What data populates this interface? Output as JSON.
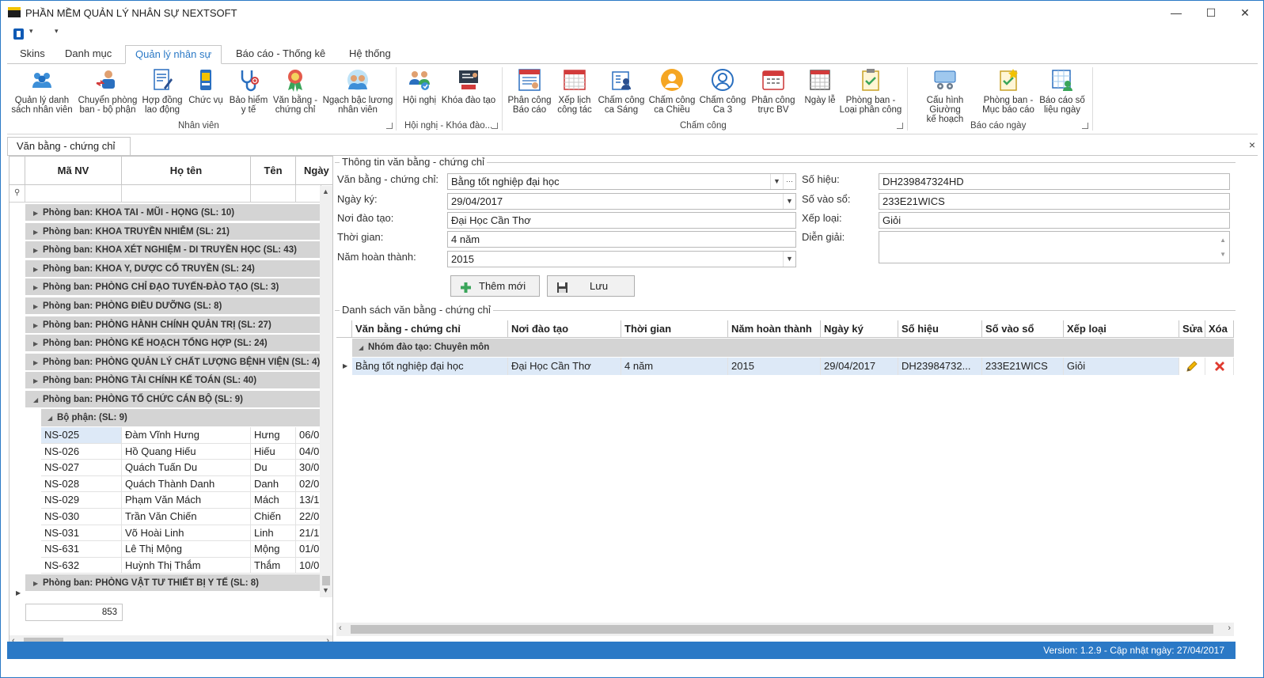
{
  "window": {
    "title": "PHẦN MỀM QUẢN LÝ NHÂN SỰ NEXTSOFT",
    "minimize": "—",
    "maximize": "☐",
    "close": "✕"
  },
  "ribbon_tabs": [
    "Skins",
    "Danh mục",
    "Quản lý nhân sự",
    "Báo cáo - Thống kê",
    "Hệ thống"
  ],
  "ribbon_groups": [
    {
      "label": "Nhân viên",
      "buttons": [
        {
          "l1": "Quản lý danh",
          "l2": "sách nhân viên",
          "icon": "people-icon"
        },
        {
          "l1": "Chuyển phòng",
          "l2": "ban - bộ phận",
          "icon": "transfer-icon"
        },
        {
          "l1": "Hợp đồng",
          "l2": "lao động",
          "icon": "contract-icon"
        },
        {
          "l1": "Chức vụ",
          "l2": "",
          "icon": "id-card-icon"
        },
        {
          "l1": "Bảo hiểm",
          "l2": "y tế",
          "icon": "stethoscope-icon"
        },
        {
          "l1": "Văn bằng -",
          "l2": "chứng chỉ",
          "icon": "medal-icon"
        },
        {
          "l1": "Ngạch bậc lương",
          "l2": "nhân viên",
          "icon": "salary-icon"
        }
      ]
    },
    {
      "label": "Hội nghị - Khóa đào...",
      "buttons": [
        {
          "l1": "Hội nghị",
          "l2": "",
          "icon": "meeting-icon"
        },
        {
          "l1": "Khóa đào tạo",
          "l2": "",
          "icon": "training-icon"
        }
      ]
    },
    {
      "label": "Chấm công",
      "buttons": [
        {
          "l1": "Phân công",
          "l2": "Báo cáo",
          "icon": "report-assign-icon"
        },
        {
          "l1": "Xếp lịch",
          "l2": "công tác",
          "icon": "calendar-grid-icon"
        },
        {
          "l1": "Chấm công",
          "l2": "ca Sáng",
          "icon": "morning-shift-icon"
        },
        {
          "l1": "Chấm công",
          "l2": "ca Chiều",
          "icon": "afternoon-shift-icon"
        },
        {
          "l1": "Chấm công",
          "l2": "Ca 3",
          "icon": "night-shift-icon"
        },
        {
          "l1": "Phân công",
          "l2": "trực BV",
          "icon": "duty-calendar-icon"
        },
        {
          "l1": "Ngày lễ",
          "l2": "",
          "icon": "holiday-calendar-icon"
        },
        {
          "l1": "Phòng ban -",
          "l2": "Loại phân công",
          "icon": "clipboard-check-icon"
        }
      ]
    },
    {
      "label": "Báo cáo ngày",
      "buttons": [
        {
          "l1": "Cấu hình Giường",
          "l2": "kế hoạch",
          "icon": "bed-config-icon"
        },
        {
          "l1": "Phòng ban -",
          "l2": "Mục báo cáo",
          "icon": "report-item-icon"
        },
        {
          "l1": "Báo cáo số",
          "l2": "liệu ngày",
          "icon": "daily-report-icon"
        }
      ]
    }
  ],
  "doc_tab": {
    "label": "Văn bằng - chứng chỉ",
    "close": "×"
  },
  "left_grid": {
    "columns": [
      "Mã NV",
      "Họ tên",
      "Tên",
      "Ngày"
    ],
    "groups_before": [
      "Phòng ban: KHOA TAI - MŨI - HỌNG (SL: 10)",
      "Phòng ban: KHOA TRUYỀN NHIỄM (SL: 21)",
      "Phòng ban: KHOA XÉT NGHIỆM - DI TRUYỀN HỌC (SL: 43)",
      "Phòng ban: KHOA Y, DƯỢC CỔ TRUYỀN (SL: 24)",
      "Phòng ban: PHÒNG CHỈ ĐẠO TUYẾN-ĐÀO TẠO (SL: 3)",
      "Phòng ban: PHÒNG ĐIỀU DƯỠNG (SL: 8)",
      "Phòng ban: PHÒNG HÀNH CHÍNH QUẢN TRỊ (SL: 27)",
      "Phòng ban: PHÒNG KẾ HOẠCH TỔNG HỢP (SL: 24)",
      "Phòng ban: PHÒNG QUẢN LÝ CHẤT LƯỢNG BỆNH VIỆN (SL: 4)",
      "Phòng ban: PHÒNG TÀI CHÍNH KẾ TOÁN (SL: 40)",
      "Phòng ban: PHÒNG TỔ CHỨC CÁN BỘ (SL: 9)"
    ],
    "subgroup": "Bộ phận:  (SL: 9)",
    "rows": [
      {
        "ma": "NS-025",
        "hoten": "Đàm Vĩnh Hưng",
        "ten": "Hưng",
        "ngay": "06/0"
      },
      {
        "ma": "NS-026",
        "hoten": "Hồ Quang Hiếu",
        "ten": "Hiếu",
        "ngay": "04/0"
      },
      {
        "ma": "NS-027",
        "hoten": "Quách Tuấn Du",
        "ten": "Du",
        "ngay": "30/0"
      },
      {
        "ma": "NS-028",
        "hoten": "Quách Thành Danh",
        "ten": "Danh",
        "ngay": "02/0"
      },
      {
        "ma": "NS-029",
        "hoten": "Phạm Văn Mách",
        "ten": "Mách",
        "ngay": "13/1"
      },
      {
        "ma": "NS-030",
        "hoten": "Trần Văn Chiến",
        "ten": "Chiến",
        "ngay": "22/0"
      },
      {
        "ma": "NS-031",
        "hoten": "Võ Hoài Linh",
        "ten": "Linh",
        "ngay": "21/1"
      },
      {
        "ma": "NS-631",
        "hoten": "Lê Thị Mộng",
        "ten": "Mộng",
        "ngay": "01/0"
      },
      {
        "ma": "NS-632",
        "hoten": "Huỳnh Thị Thắm",
        "ten": "Thắm",
        "ngay": "10/0"
      }
    ],
    "group_after": "Phòng ban: PHÒNG VẬT TƯ THIẾT BỊ Y TẾ (SL: 8)",
    "total_count": "853"
  },
  "form": {
    "title": "Thông tin văn bằng - chứng chỉ",
    "van_bang_label": "Văn bằng - chứng chỉ:",
    "van_bang_value": "Bằng tốt nghiệp đại học",
    "ngay_ky_label": "Ngày ký:",
    "ngay_ky_value": "29/04/2017",
    "noi_dao_tao_label": "Nơi đào tạo:",
    "noi_dao_tao_value": "Đại Học Cần Thơ",
    "thoi_gian_label": "Thời gian:",
    "thoi_gian_value": "4 năm",
    "nam_hoan_thanh_label": "Năm hoàn thành:",
    "nam_hoan_thanh_value": "2015",
    "so_hieu_label": "Số hiệu:",
    "so_hieu_value": "DH239847324HD",
    "so_vao_so_label": "Số vào sổ:",
    "so_vao_so_value": "233E21WICS",
    "xep_loai_label": "Xếp loại:",
    "xep_loai_value": "Giỏi",
    "dien_giai_label": "Diễn giải:",
    "dien_giai_value": "",
    "add_label": "Thêm mới",
    "save_label": "Lưu"
  },
  "list": {
    "title": "Danh sách văn bằng - chứng chỉ",
    "columns": [
      "Văn bằng - chứng chỉ",
      "Nơi đào tạo",
      "Thời gian",
      "Năm hoàn thành",
      "Ngày ký",
      "Số hiệu",
      "Số vào sổ",
      "Xếp loại",
      "Sửa",
      "Xóa"
    ],
    "group": "Nhóm đào tạo: Chuyên môn",
    "rows": [
      {
        "van_bang": "Bằng tốt nghiệp đại học",
        "noi_dao_tao": "Đại Học Cần Thơ",
        "thoi_gian": "4 năm",
        "nam": "2015",
        "ngay_ky": "29/04/2017",
        "so_hieu": "DH23984732...",
        "so_vao_so": "233E21WICS",
        "xep_loai": "Giỏi"
      }
    ]
  },
  "status": {
    "text": "Version: 1.2.9 - Cập nhật ngày: 27/04/2017"
  }
}
